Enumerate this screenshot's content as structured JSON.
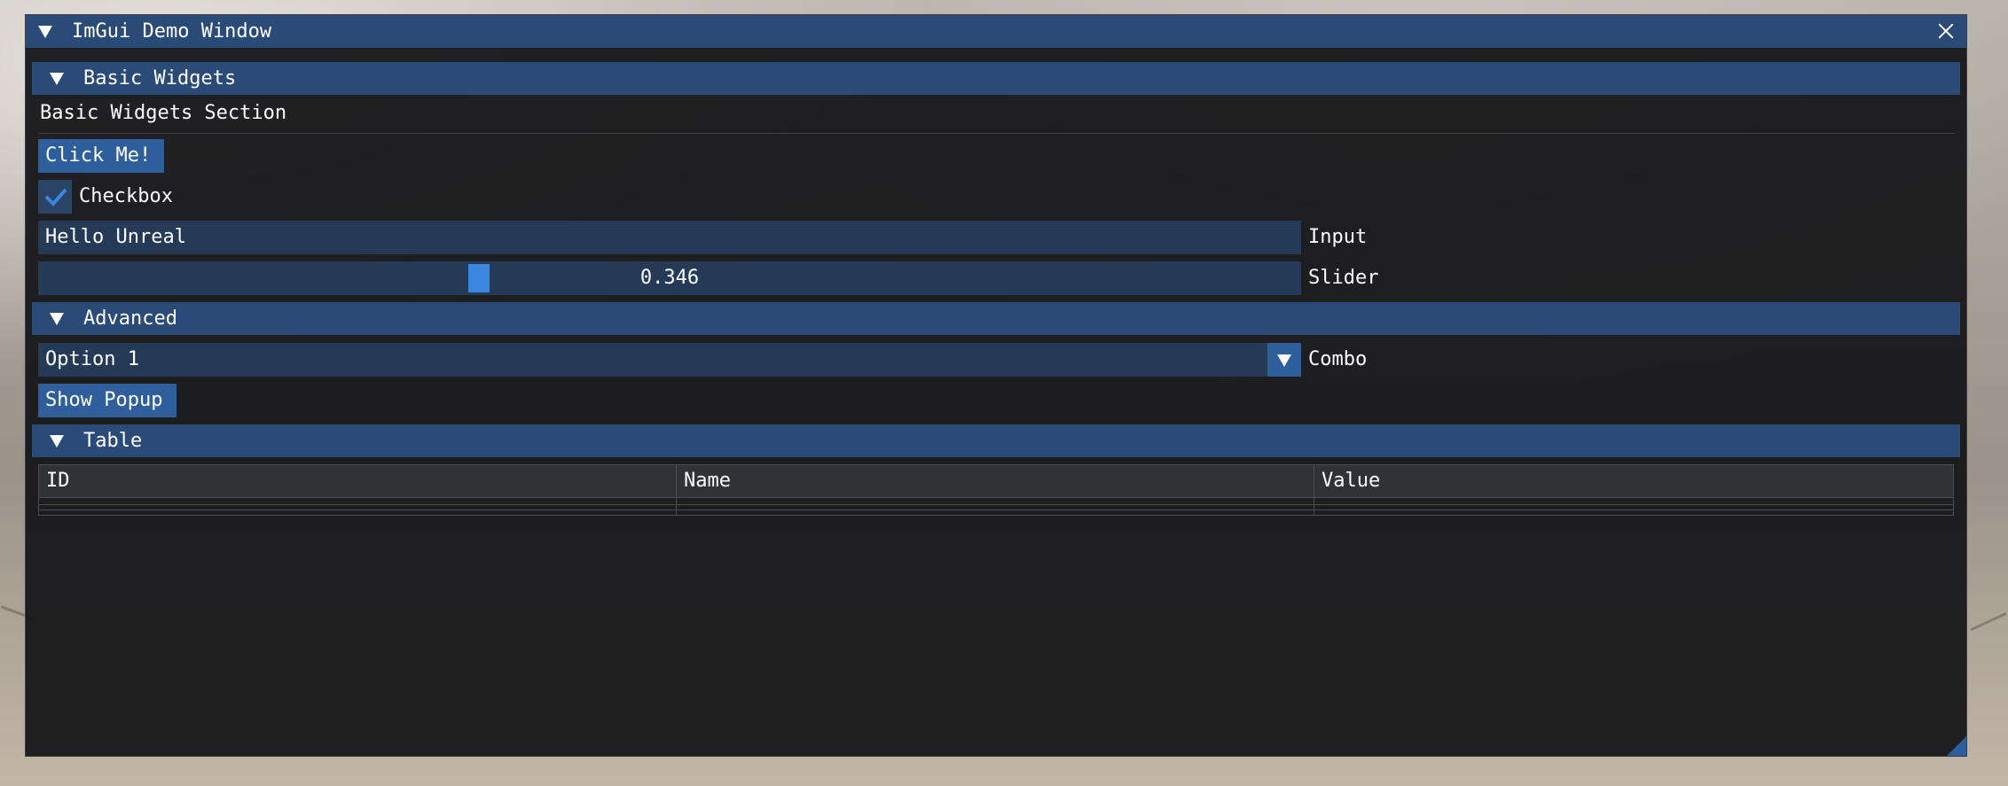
{
  "window": {
    "title": "ImGui Demo Window",
    "colors": {
      "titlebar": "#2a4a78",
      "header": "#2a4a78",
      "button": "#2e5f9c",
      "frame": "#253a57",
      "accent": "#3b86e0",
      "background": "#18181a"
    }
  },
  "basic": {
    "header": "Basic Widgets",
    "section_text": "Basic Widgets Section",
    "button_label": "Click Me!",
    "checkbox_label": "Checkbox",
    "checkbox_checked": true,
    "input_value": "Hello Unreal",
    "input_label": "Input",
    "slider_value": "0.346",
    "slider_label": "Slider"
  },
  "advanced": {
    "header": "Advanced",
    "combo_value": "Option 1",
    "combo_label": "Combo",
    "popup_button": "Show Popup"
  },
  "table": {
    "header": "Table",
    "columns": [
      "ID",
      "Name",
      "Value"
    ]
  },
  "icons": [
    "collapse-arrow-icon",
    "close-icon",
    "check-icon",
    "dropdown-arrow-icon",
    "resize-grip-icon"
  ]
}
